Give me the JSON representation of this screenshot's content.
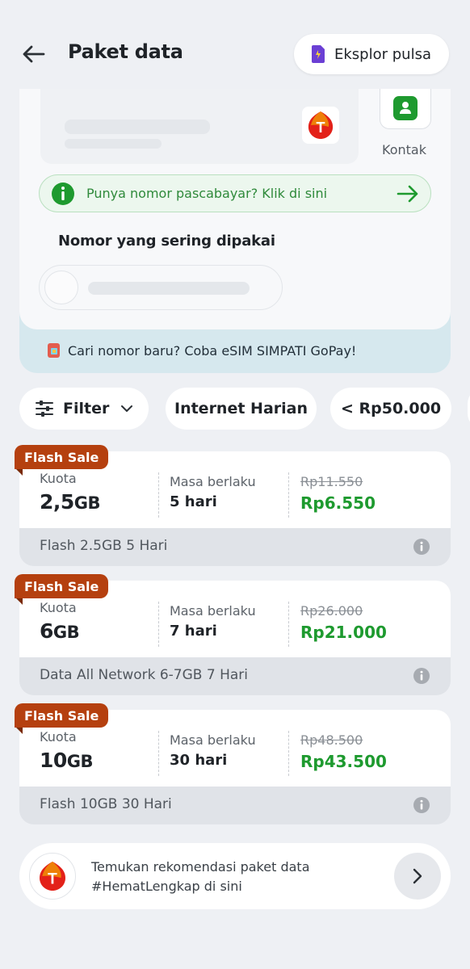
{
  "header": {
    "title": "Paket data",
    "eksplor_label": "Eksplor pulsa"
  },
  "input_card": {
    "kontak_label": "Kontak",
    "pascabayar_text": "Punya nomor pascabayar? Klik di sini",
    "frequent_title": "Nomor yang sering dipakai",
    "esim_text": "Cari nomor baru? Coba eSIM SIMPATI GoPay!"
  },
  "filters": {
    "filter_label": "Filter",
    "chip_internet": "Internet Harian",
    "chip_price": "< Rp50.000"
  },
  "packages": [
    {
      "badge": "Flash Sale",
      "quota_label": "Kuota",
      "quota_value": "2,5",
      "quota_unit": "GB",
      "validity_label": "Masa berlaku",
      "validity_value": "5 hari",
      "old_price": "Rp11.550",
      "new_price": "Rp6.550",
      "name": "Flash 2.5GB 5 Hari"
    },
    {
      "badge": "Flash Sale",
      "quota_label": "Kuota",
      "quota_value": "6",
      "quota_unit": "GB",
      "validity_label": "Masa berlaku",
      "validity_value": "7 hari",
      "old_price": "Rp26.000",
      "new_price": "Rp21.000",
      "name": "Data All Network 6-7GB 7 Hari"
    },
    {
      "badge": "Flash Sale",
      "quota_label": "Kuota",
      "quota_value": "10",
      "quota_unit": "GB",
      "validity_label": "Masa berlaku",
      "validity_value": "30 hari",
      "old_price": "Rp48.500",
      "new_price": "Rp43.500",
      "name": "Flash 10GB 30 Hari"
    }
  ],
  "recommendation": {
    "line1": "Temukan rekomendasi paket data",
    "line2": "#HematLengkap di sini"
  },
  "colors": {
    "accent_green": "#1e9a2f",
    "flash_badge": "#b5400f",
    "telkomsel_red": "#e32119"
  },
  "icons": [
    "back-arrow-icon",
    "sim-card-icon",
    "telkomsel-logo",
    "contact-icon",
    "info-icon",
    "arrow-right-icon",
    "esim-icon",
    "filter-sliders-icon",
    "chevron-down-icon",
    "chevron-right-icon"
  ]
}
